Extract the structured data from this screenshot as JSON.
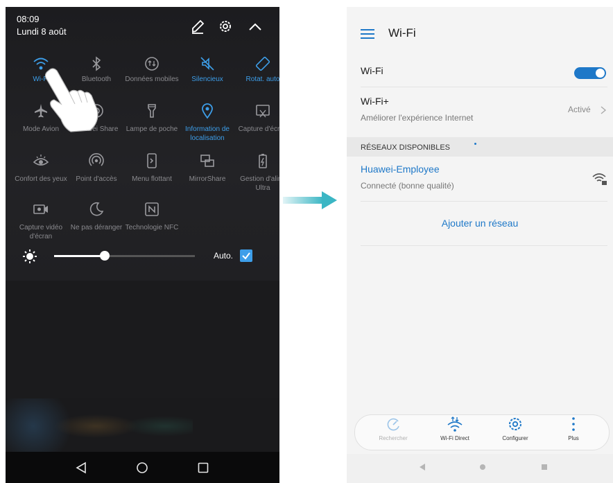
{
  "left": {
    "time": "08:09",
    "date": "Lundi 8 août",
    "tiles": [
      {
        "label": "Wi-Fi",
        "icon": "wifi-icon",
        "active": true
      },
      {
        "label": "Bluetooth",
        "icon": "bluetooth-icon",
        "active": false
      },
      {
        "label": "Données mobiles",
        "icon": "mobile-data-icon",
        "active": false
      },
      {
        "label": "Silencieux",
        "icon": "silent-icon",
        "active": true
      },
      {
        "label": "Rotat. auto",
        "icon": "auto-rotate-icon",
        "active": true
      },
      {
        "label": "Mode Avion",
        "icon": "airplane-icon",
        "active": false
      },
      {
        "label": "Huawei Share",
        "icon": "huawei-share-icon",
        "active": false
      },
      {
        "label": "Lampe de poche",
        "icon": "flashlight-icon",
        "active": false
      },
      {
        "label": "Information de localisation",
        "icon": "location-icon",
        "active": true
      },
      {
        "label": "Capture d'écran",
        "icon": "screenshot-icon",
        "active": false
      },
      {
        "label": "Confort des yeux",
        "icon": "eye-comfort-icon",
        "active": false
      },
      {
        "label": "Point d'accès",
        "icon": "hotspot-icon",
        "active": false
      },
      {
        "label": "Menu flottant",
        "icon": "floating-menu-icon",
        "active": false
      },
      {
        "label": "MirrorShare",
        "icon": "mirrorshare-icon",
        "active": false
      },
      {
        "label": "Gestion d'alim. Ultra",
        "icon": "ultra-power-icon",
        "active": false
      },
      {
        "label": "Capture vidéo d'écran",
        "icon": "screen-record-icon",
        "active": false
      },
      {
        "label": "Ne pas déranger",
        "icon": "do-not-disturb-icon",
        "active": false
      },
      {
        "label": "Technologie NFC",
        "icon": "nfc-icon",
        "active": false
      }
    ],
    "brightness_level": 0.36,
    "auto_label": "Auto.",
    "auto_checked": true
  },
  "right": {
    "title": "Wi-Fi",
    "wifi_label": "Wi-Fi",
    "wifi_on": true,
    "wifiplus_title": "Wi-Fi+",
    "wifiplus_subtitle": "Améliorer l'expérience Internet",
    "wifiplus_status": "Activé",
    "section_header": "RÉSEAUX DISPONIBLES",
    "network_name": "Huawei-Employee",
    "network_status": "Connecté (bonne qualité)",
    "add_network": "Ajouter un réseau",
    "bottom_actions": [
      "Rechercher",
      "Wi-Fi Direct",
      "Configurer",
      "Plus"
    ]
  },
  "colors": {
    "accent": "#3d9ee9",
    "link": "#1e78c8",
    "arrow": "#3bb6c4"
  }
}
